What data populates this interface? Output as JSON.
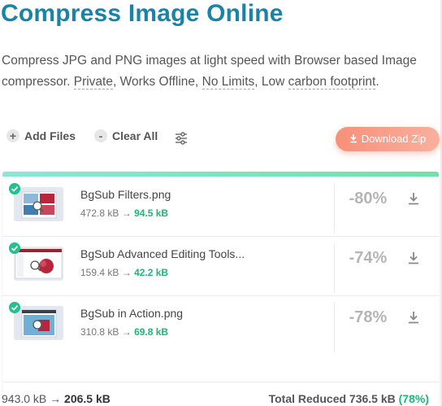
{
  "header": {
    "title": "Compress Image Online",
    "desc_pre": "Compress JPG and PNG images at light speed with Browser based Image compressor. ",
    "private": "Private",
    "sep1": ", Works Offline, ",
    "no_limits": "No Limits",
    "sep2": ", Low ",
    "carbon": "carbon footprint",
    "end": "."
  },
  "toolbar": {
    "add_icon": "+",
    "add_label": "Add Files",
    "clear_icon": "-",
    "clear_label": "Clear All",
    "settings_icon": "sliders-icon",
    "download_zip_label": "Download Zip"
  },
  "files": [
    {
      "name": "BgSub Filters.png",
      "original": "472.8 kB",
      "arrow": "→",
      "compressed": "94.5 kB",
      "reduction": "-80%"
    },
    {
      "name": "BgSub Advanced Editing Tools...",
      "original": "159.4 kB",
      "arrow": "→",
      "compressed": "42.2 kB",
      "reduction": "-74%"
    },
    {
      "name": "BgSub in Action.png",
      "original": "310.8 kB",
      "arrow": "→",
      "compressed": "69.8 kB",
      "reduction": "-78%"
    }
  ],
  "footer": {
    "original_total": "943.0 kB",
    "arrow": "→",
    "compressed_total": "206.5 kB",
    "reduced_label": "Total Reduced",
    "reduced_value": "736.5 kB",
    "reduced_pct": "(78%)"
  },
  "colors": {
    "title": "#1a84a8",
    "accent_green": "#1fb776",
    "download_zip": "#f7907a"
  }
}
